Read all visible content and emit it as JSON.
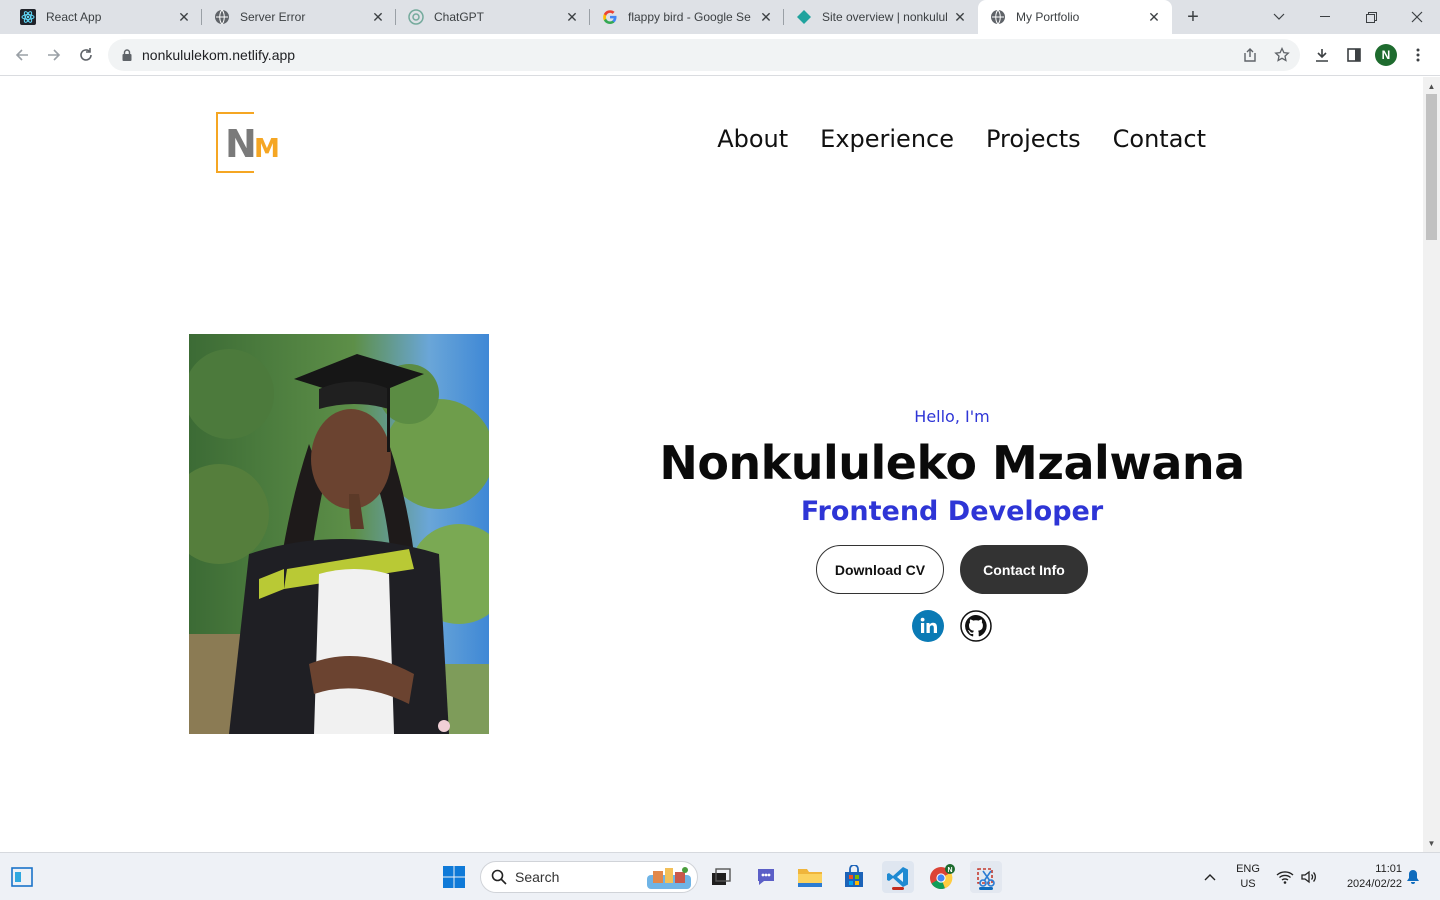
{
  "browser": {
    "tabs": [
      {
        "label": "React App",
        "icon": "react-icon"
      },
      {
        "label": "Server Error",
        "icon": "globe-icon"
      },
      {
        "label": "ChatGPT",
        "icon": "chatgpt-icon"
      },
      {
        "label": "flappy bird - Google Se",
        "icon": "google-icon"
      },
      {
        "label": "Site overview | nonkulul",
        "icon": "netlify-icon"
      },
      {
        "label": "My Portfolio",
        "icon": "globe-icon",
        "active": true
      }
    ],
    "url": "nonkululekom.netlify.app",
    "profile_initial": "N"
  },
  "site": {
    "logo": {
      "n": "N",
      "m": "M"
    },
    "nav": [
      "About",
      "Experience",
      "Projects",
      "Contact"
    ],
    "hero": {
      "greeting": "Hello, I'm",
      "name": "Nonkululeko Mzalwana",
      "role": "Frontend Developer",
      "btn_cv": "Download CV",
      "btn_contact": "Contact Info"
    },
    "social": [
      "linkedin-icon",
      "github-icon"
    ]
  },
  "taskbar": {
    "search_placeholder": "Search",
    "lang_top": "ENG",
    "lang_bottom": "US",
    "time": "11:01",
    "date": "2024/02/22"
  },
  "colors": {
    "accent_blue": "#2e35d6",
    "logo_orange": "#f5a623",
    "button_dark": "#333333"
  }
}
